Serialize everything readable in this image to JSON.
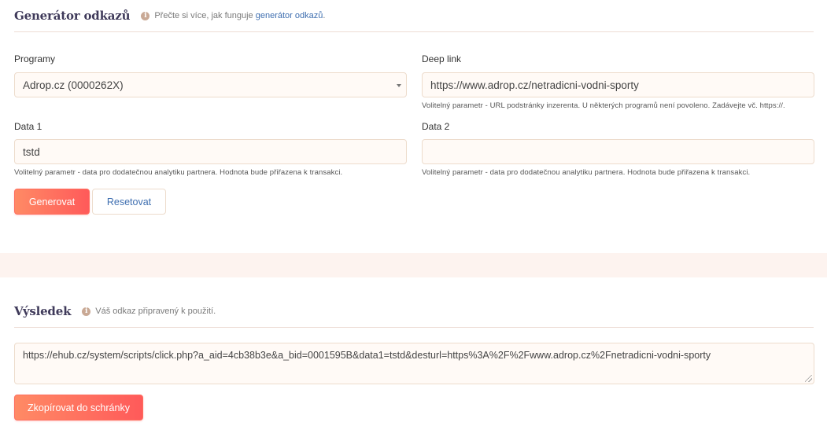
{
  "generator": {
    "title": "Generátor odkazů",
    "info_icon": "info-icon",
    "note_prefix": "Přečte si více, jak funguje ",
    "note_link": "generátor odkazů",
    "note_suffix": "."
  },
  "form": {
    "programs": {
      "label": "Programy",
      "value": "Adrop.cz (0000262X)"
    },
    "deep_link": {
      "label": "Deep link",
      "value": "https://www.adrop.cz/netradicni-vodni-sporty",
      "help": "Volitelný parametr - URL podstránky inzerenta. U některých programů není povoleno. Zadávejte vč. https://."
    },
    "data1": {
      "label": "Data 1",
      "value": "tstd",
      "help": "Volitelný parametr - data pro dodatečnou analytiku partnera. Hodnota bude přiřazena k transakci."
    },
    "data2": {
      "label": "Data 2",
      "value": "",
      "help": "Volitelný parametr - data pro dodatečnou analytiku partnera. Hodnota bude přiřazena k transakci."
    },
    "generate_label": "Generovat",
    "reset_label": "Resetovat"
  },
  "result": {
    "title": "Výsledek",
    "note": "Váš odkaz připravený k použití.",
    "url": "https://ehub.cz/system/scripts/click.php?a_aid=4cb38b3e&a_bid=0001595B&data1=tstd&desturl=https%3A%2F%2Fwww.adrop.cz%2Fnetradicni-vodni-sporty",
    "copy_label": "Zkopírovat do schránky"
  },
  "colors": {
    "accent_start": "#ff8a65",
    "accent_end": "#ff5a5a",
    "link": "#3f6fb0",
    "title": "#3f3a5a",
    "band": "#fdf3ef"
  }
}
